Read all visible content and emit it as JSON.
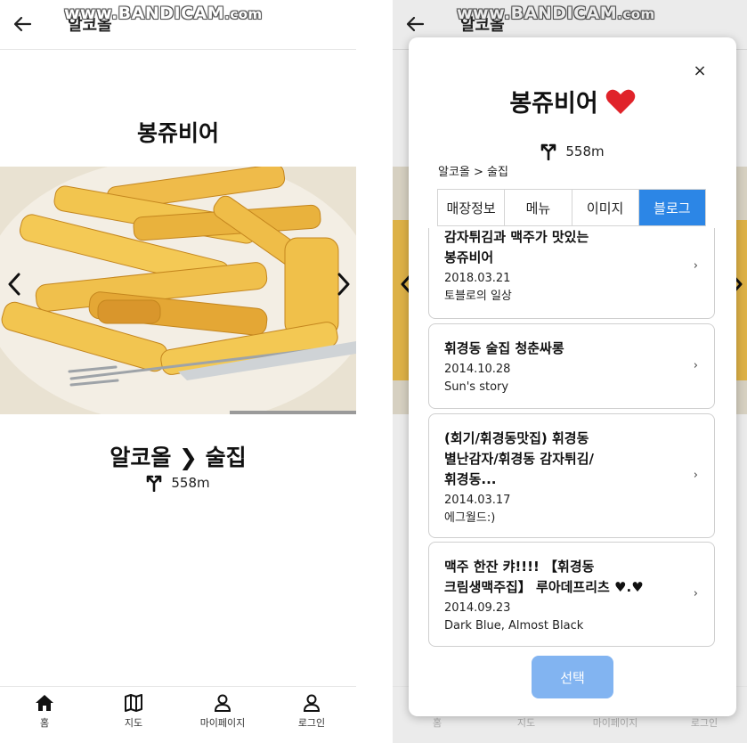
{
  "watermark": {
    "main": "www.BANDICAM",
    "suffix": ".com"
  },
  "header": {
    "title": "알코올"
  },
  "store": {
    "name": "봉쥬비어",
    "category": "알코올 > 술집",
    "category_bold": "알코올 ❯ 술집",
    "distance": "558m"
  },
  "nav": {
    "home": "홈",
    "map": "지도",
    "mypage": "마이페이지",
    "login": "로그인"
  },
  "modal": {
    "title": "봉쥬비어",
    "heart": "❤️",
    "close": "×",
    "tabs": [
      {
        "label": "매장정보",
        "active": false
      },
      {
        "label": "메뉴",
        "active": false
      },
      {
        "label": "이미지",
        "active": false
      },
      {
        "label": "블로그",
        "active": true
      }
    ],
    "blogs": [
      {
        "title_line1": "감자튀김과 맥주가 맛있는",
        "title_line2": "봉쥬비어",
        "title_line3": "",
        "date": "2018.03.21",
        "source": "토블로의 일상"
      },
      {
        "title_line1": "휘경동 술집 청춘싸롱",
        "title_line2": "",
        "title_line3": "",
        "date": "2014.10.28",
        "source": "Sun's story"
      },
      {
        "title_line1": "(회기/휘경동맛집) 휘경동",
        "title_line2": "별난감자/휘경동 감자튀김/",
        "title_line3": "휘경동...",
        "date": "2014.03.17",
        "source": "에그월드:)"
      },
      {
        "title_line1": "맥주 한잔 캬!!!! 【휘경동",
        "title_line2": "크림생맥주집】 루아데프리츠 ♥.♥",
        "title_line3": "",
        "date": "2014.09.23",
        "source": "Dark Blue, Almost Black"
      }
    ],
    "chevron": "›",
    "select_button": "선택"
  },
  "colors": {
    "accent": "#2c86e6",
    "select_button": "#82b4f1"
  }
}
